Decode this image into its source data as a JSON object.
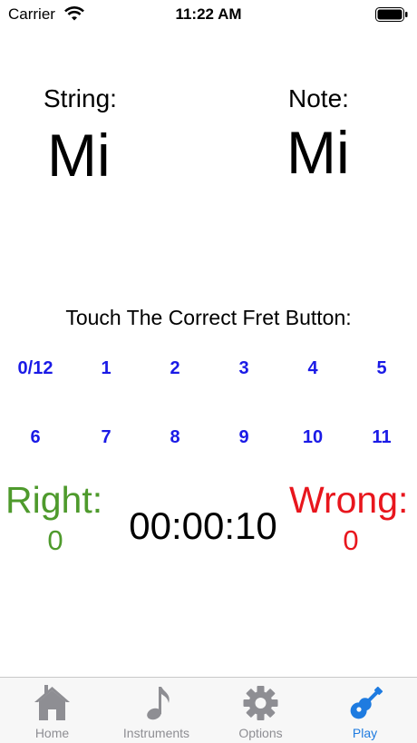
{
  "status_bar": {
    "carrier": "Carrier",
    "time": "11:22 AM",
    "icons": [
      "wifi-icon",
      "battery-icon"
    ]
  },
  "string_label": "String:",
  "string_value": "Mi",
  "note_label": "Note:",
  "note_value": "Mi",
  "instruction": "Touch The Correct Fret Button:",
  "frets": {
    "row1": [
      "0/12",
      "1",
      "2",
      "3",
      "4",
      "5"
    ],
    "row2": [
      "6",
      "7",
      "8",
      "9",
      "10",
      "11"
    ]
  },
  "score": {
    "right_label": "Right:",
    "right_count": "0",
    "wrong_label": "Wrong:",
    "wrong_count": "0",
    "timer": "00:00:10"
  },
  "tabs": [
    {
      "label": "Home",
      "icon": "home-icon"
    },
    {
      "label": "Instruments",
      "icon": "music-note-icon"
    },
    {
      "label": "Options",
      "icon": "gear-icon"
    },
    {
      "label": "Play",
      "icon": "guitar-icon"
    }
  ],
  "colors": {
    "right": "#4e9a2c",
    "wrong": "#e8161d",
    "fret": "#1a1ae6",
    "active_tab": "#1e7be0",
    "inactive_tab": "#8e8e93"
  }
}
